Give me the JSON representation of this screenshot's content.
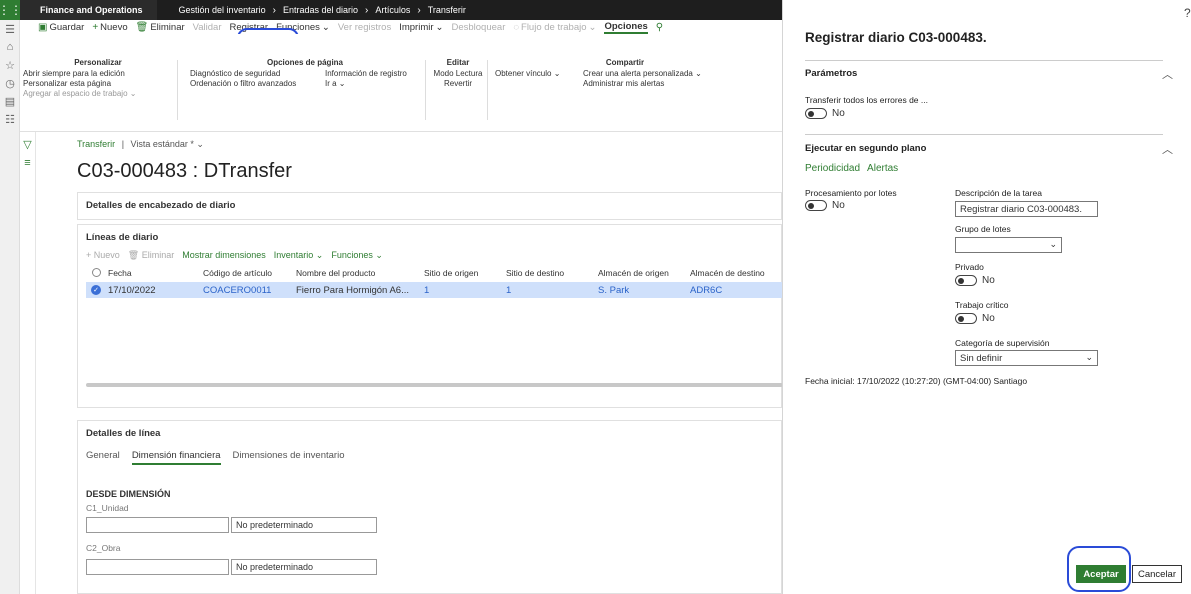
{
  "topbar": {
    "app": "Finance and Operations",
    "crumbs": [
      "Gestión del inventario",
      "Entradas del diario",
      "Artículos",
      "Transferir"
    ]
  },
  "actions": {
    "save": "Guardar",
    "new": "Nuevo",
    "delete": "Eliminar",
    "validate": "Validar",
    "post": "Registrar",
    "functions": "Funciones",
    "view_records": "Ver registros",
    "print": "Imprimir",
    "unlock": "Desbloquear",
    "workflow": "Flujo de trabajo",
    "options": "Opciones"
  },
  "ribbon": {
    "personalize": {
      "title": "Personalizar",
      "items": [
        "Abrir siempre para la edición",
        "Personalizar esta página",
        "Agregar al espacio de trabajo"
      ]
    },
    "page_options": {
      "title": "Opciones de página",
      "items": [
        "Diagnóstico de seguridad",
        "Ordenación o filtro avanzados",
        "Información de registro",
        "Ir a"
      ]
    },
    "edit": {
      "title": "Editar",
      "items": [
        "Modo Lectura",
        "Revertir"
      ]
    },
    "share": {
      "title": "Compartir",
      "items": [
        "Obtener vínculo",
        "Crear una alerta personalizada",
        "Administrar mis alertas"
      ]
    }
  },
  "page": {
    "breadcrumb_link": "Transferir",
    "breadcrumb_sep": "|",
    "view_name": "Vista estándar *",
    "title": "C03-000483 : DTransfer",
    "header_details": "Detalles de encabezado de diario",
    "journal_lines": "Líneas de diario",
    "line_details": "Detalles de línea"
  },
  "lines_toolbar": {
    "new": "Nuevo",
    "delete": "Eliminar",
    "show_dimensions": "Mostrar dimensiones",
    "inventory": "Inventario",
    "functions": "Funciones"
  },
  "grid": {
    "columns": [
      "Fecha",
      "Código de artículo",
      "Nombre del producto",
      "Sitio de origen",
      "Sitio de destino",
      "Almacén de origen",
      "Almacén de destino"
    ],
    "rows": [
      [
        "17/10/2022",
        "COACERO0011",
        "Fierro Para Hormigón A6...",
        "1",
        "1",
        "S. Park",
        "ADR6C"
      ]
    ]
  },
  "line_tabs": [
    "General",
    "Dimensión financiera",
    "Dimensiones de inventario"
  ],
  "dimensions": {
    "from_label": "DESDE DIMENSIÓN",
    "dim1": "C1_Unidad",
    "dim1_value": "No predeterminado",
    "dim2": "C2_Obra",
    "dim2_value": "No predeterminado"
  },
  "panel": {
    "title": "Registrar diario C03-000483.",
    "help": "?",
    "params_title": "Parámetros",
    "transfer_errors_label": "Transferir todos los errores de ...",
    "transfer_errors_value": "No",
    "background_title": "Ejecutar en segundo plano",
    "recurrence": "Periodicidad",
    "alerts": "Alertas",
    "batch_label": "Procesamiento por lotes",
    "batch_value": "No",
    "task_desc_label": "Descripción de la tarea",
    "task_desc_value": "Registrar diario C03-000483.",
    "batch_group_label": "Grupo de lotes",
    "batch_group_value": "",
    "private_label": "Privado",
    "private_value": "No",
    "critical_label": "Trabajo crítico",
    "critical_value": "No",
    "monitoring_label": "Categoría de supervisión",
    "monitoring_value": "Sin definir",
    "start_date": "Fecha inicial: 17/10/2022 (10:27:20) (GMT-04:00) Santiago",
    "ok": "Aceptar",
    "cancel": "Cancelar"
  },
  "colors": {
    "accent": "#2f7d32",
    "highlight": "#2a4bd7",
    "selected_row": "#cfe0fb"
  }
}
